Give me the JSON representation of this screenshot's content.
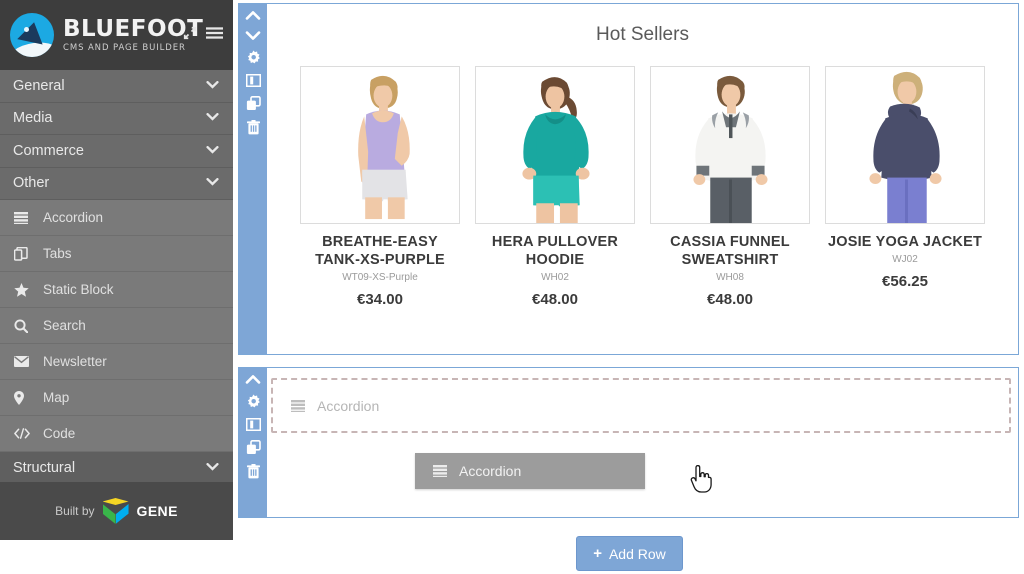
{
  "brand": {
    "title": "BLUEFOOT",
    "subtitle": "CMS AND PAGE BUILDER",
    "logo_icon": "bluefoot-logo-icon",
    "expand_icon": "expand-arrows-icon",
    "menu_icon": "hamburger-menu-icon",
    "header_bg": "#3d3d3d"
  },
  "sidebar": {
    "groups": [
      {
        "label": "General",
        "expanded": false
      },
      {
        "label": "Media",
        "expanded": false
      },
      {
        "label": "Commerce",
        "expanded": false
      },
      {
        "label": "Other",
        "expanded": true
      }
    ],
    "items": [
      {
        "label": "Accordion",
        "icon": "list-rows-icon"
      },
      {
        "label": "Tabs",
        "icon": "copy-tabs-icon"
      },
      {
        "label": "Static Block",
        "icon": "star-icon"
      },
      {
        "label": "Search",
        "icon": "search-icon"
      },
      {
        "label": "Newsletter",
        "icon": "envelope-icon"
      },
      {
        "label": "Map",
        "icon": "map-pin-icon"
      },
      {
        "label": "Code",
        "icon": "code-brackets-icon"
      }
    ],
    "structural": {
      "label": "Structural"
    },
    "footer": {
      "built_by": "Built by",
      "company": "GENE",
      "logo_icon": "gene-cube-icon"
    },
    "colors": {
      "bg": "#6b6b6b",
      "item_bg": "#7a7a7a",
      "footer_bg": "#4a4a4a"
    }
  },
  "canvas": {
    "accent": "#7ea6d6",
    "row1": {
      "toolbar": [
        {
          "icon": "chevron-up-icon",
          "name": "move-row-up"
        },
        {
          "icon": "chevron-down-icon",
          "name": "move-row-down"
        },
        {
          "icon": "gear-icon",
          "name": "row-settings"
        },
        {
          "icon": "columns-icon",
          "name": "row-columns"
        },
        {
          "icon": "duplicate-icon",
          "name": "duplicate-row"
        },
        {
          "icon": "trash-icon",
          "name": "delete-row"
        }
      ],
      "title": "Hot Sellers",
      "products": [
        {
          "name": "BREATHE-EASY TANK-XS-PURPLE",
          "sku": "WT09-XS-Purple",
          "price": "€34.00",
          "image": "woman-in-purple-tank-top",
          "garment_color": "#b9abe0",
          "hair": "#c8a063"
        },
        {
          "name": "HERA PULLOVER HOODIE",
          "sku": "WH02",
          "price": "€48.00",
          "image": "woman-in-teal-pullover-hoodie",
          "garment_color": "#19a8a0",
          "hair": "#6b4a33"
        },
        {
          "name": "CASSIA FUNNEL SWEATSHIRT",
          "sku": "WH08",
          "price": "€48.00",
          "image": "woman-in-white-funnel-sweatshirt",
          "garment_color": "#f4f4f2",
          "hair": "#7a5a3c"
        },
        {
          "name": "JOSIE YOGA JACKET",
          "sku": "WJ02",
          "price": "€56.25",
          "image": "woman-in-navy-yoga-jacket",
          "garment_color": "#4a4e6b",
          "hair": "#cdb07a"
        }
      ]
    },
    "row2": {
      "toolbar": [
        {
          "icon": "chevron-up-icon",
          "name": "move-row-up"
        },
        {
          "icon": "gear-icon",
          "name": "row-settings"
        },
        {
          "icon": "columns-icon",
          "name": "row-columns"
        },
        {
          "icon": "duplicate-icon",
          "name": "duplicate-row"
        },
        {
          "icon": "trash-icon",
          "name": "delete-row"
        }
      ],
      "dropzone": {
        "label": "Accordion",
        "icon": "list-rows-icon"
      },
      "drag_ghost": {
        "label": "Accordion",
        "icon": "list-rows-icon",
        "cursor": "pointer-hand-cursor"
      }
    },
    "add_row": {
      "label": "Add Row",
      "icon": "plus-icon"
    }
  }
}
